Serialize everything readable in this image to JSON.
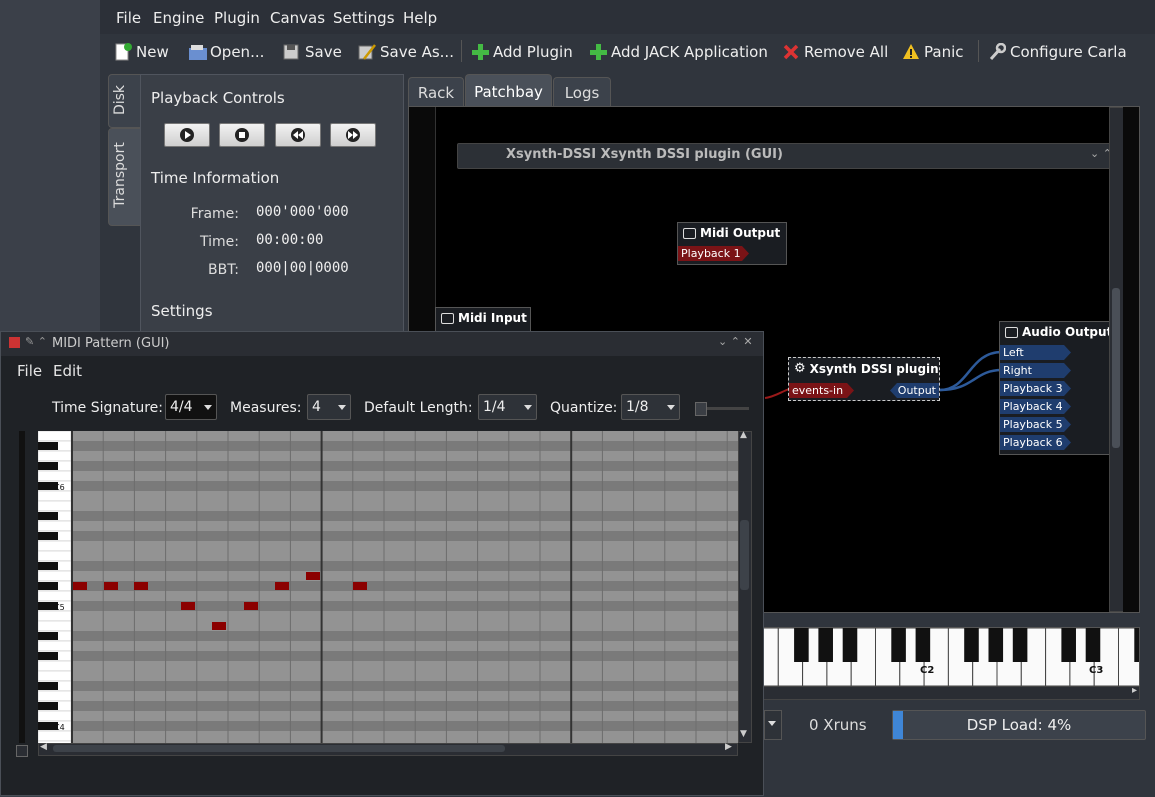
{
  "main_window": {
    "menu": [
      "File",
      "Engine",
      "Plugin",
      "Canvas",
      "Settings",
      "Help"
    ],
    "toolbar": {
      "new": "New",
      "open": "Open...",
      "save": "Save",
      "save_as": "Save As...",
      "add_plugin": "Add Plugin",
      "add_jack_app": "Add JACK Application",
      "remove_all": "Remove All",
      "panic": "Panic",
      "configure": "Configure Carla"
    },
    "side_tabs": [
      "Disk",
      "Transport"
    ],
    "transport": {
      "playback_title": "Playback Controls",
      "time_info_title": "Time Information",
      "frame_label": "Frame:",
      "frame_value": "000'000'000",
      "time_label": "Time:",
      "time_value": "00:00:00",
      "bbt_label": "BBT:",
      "bbt_value": "000|00|0000",
      "settings_title": "Settings"
    },
    "tabs": [
      "Rack",
      "Patchbay",
      "Logs"
    ],
    "active_tab": "Patchbay",
    "patchbay": {
      "embedded_window_title": "Xsynth-DSSI Xsynth DSSI plugin (GUI)",
      "midi_output": {
        "title": "Midi Output",
        "ports": [
          "Playback 1"
        ]
      },
      "midi_input": {
        "title": "Midi Input"
      },
      "plugin": {
        "title": "Xsynth DSSI plugin",
        "in_port": "events-in",
        "out_port": "Output"
      },
      "audio_output": {
        "title": "Audio Output",
        "ports": [
          "Left",
          "Right",
          "Playback 3",
          "Playback 4",
          "Playback 5",
          "Playback 6"
        ]
      }
    },
    "keyboard_labels": [
      "C2",
      "C3"
    ],
    "status": {
      "xruns": "0 Xruns",
      "dsp_load": "DSP Load: 4%",
      "dsp_fraction": 0.04
    }
  },
  "pattern_window": {
    "title": "MIDI Pattern (GUI)",
    "menu": [
      "File",
      "Edit"
    ],
    "time_signature_label": "Time Signature:",
    "time_signature_value": "4/4",
    "measures_label": "Measures:",
    "measures_value": "4",
    "default_length_label": "Default Length:",
    "default_length_value": "1/4",
    "quantize_label": "Quantize:",
    "quantize_value": "1/8",
    "piano_labels": [
      "C6",
      "C5",
      "C4"
    ]
  },
  "colors": {
    "note": "#8b0000",
    "port_midi": "#7a1316",
    "port_audio": "#1f3d6e"
  }
}
